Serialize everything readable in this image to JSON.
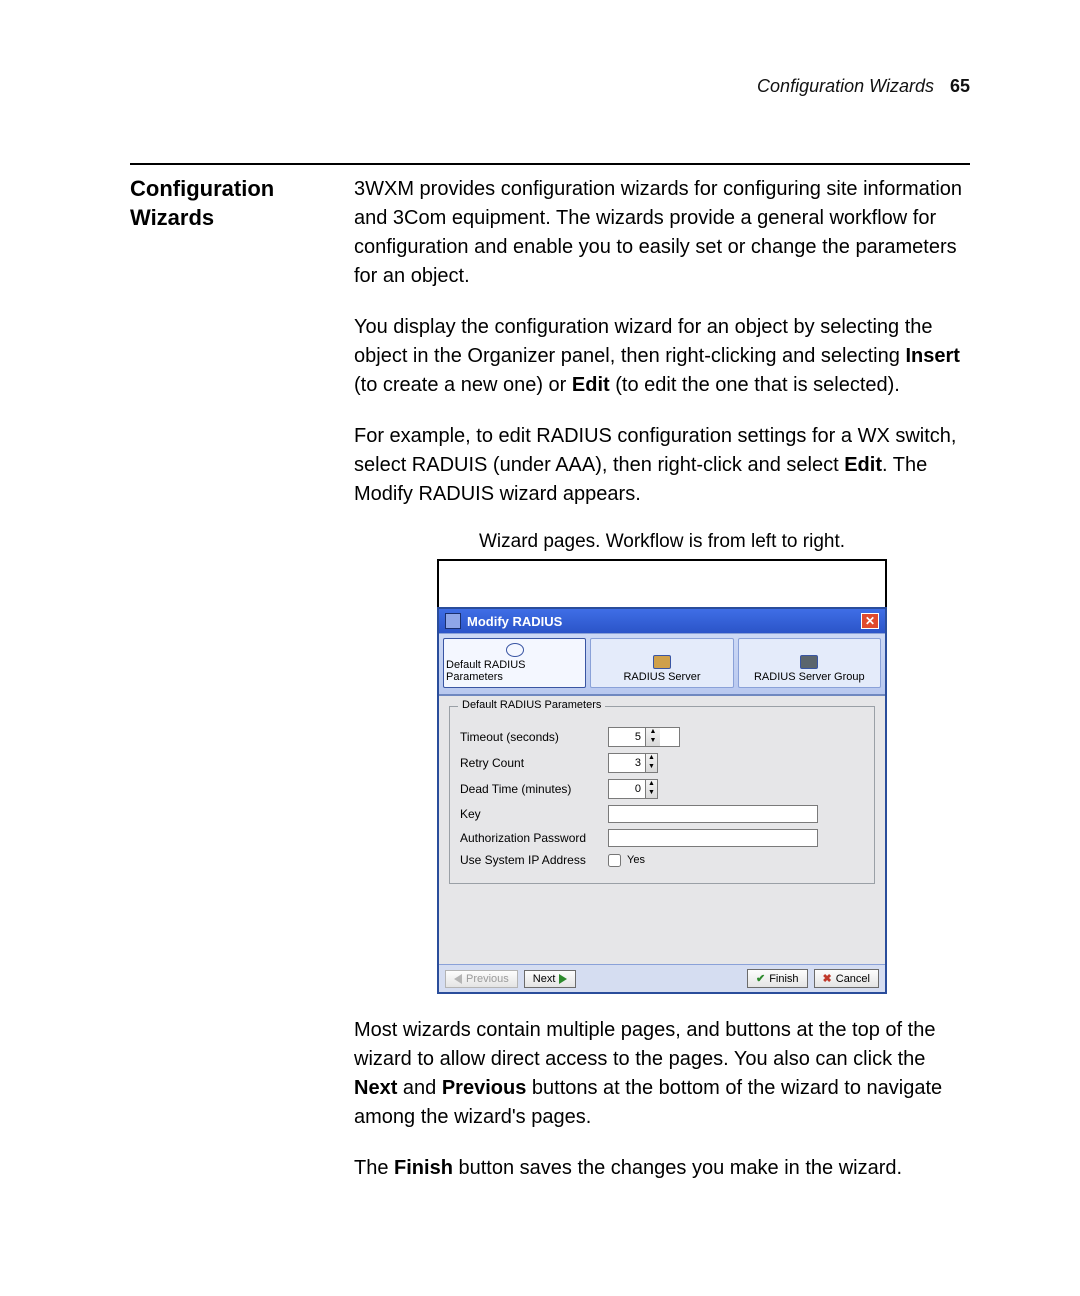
{
  "header": {
    "section_name": "Configuration Wizards",
    "page_number": "65"
  },
  "sidebar": {
    "heading_line1": "Configuration",
    "heading_line2": "Wizards"
  },
  "body": {
    "p1": "3WXM provides configuration wizards for configuring site information and 3Com equipment. The wizards provide a general workflow for configuration and enable you to easily set or change the parameters for an object.",
    "p2a": "You display the configuration wizard for an object by selecting the object in the Organizer panel, then right-clicking and selecting ",
    "p2b_insert": "Insert",
    "p2c": " (to create a new one) or ",
    "p2d_edit": "Edit",
    "p2e": " (to edit the one that is selected).",
    "p3a": "For example, to edit RADIUS configuration settings for a WX switch, select RADUIS (under AAA), then right-click and select ",
    "p3b_edit": "Edit",
    "p3c": ". The Modify RADUIS wizard appears.",
    "caption": "Wizard pages. Workflow is from left to right.",
    "p4a": "Most wizards contain multiple pages, and buttons at the top of the wizard to allow direct access to the pages. You also can click the ",
    "p4b_next": "Next",
    "p4c": " and ",
    "p4d_prev": "Previous",
    "p4e": " buttons at the bottom of the wizard to navigate among the wizard's pages.",
    "p5a": "The ",
    "p5b_finish": "Finish",
    "p5c": " button saves the changes you make in the wizard."
  },
  "dialog": {
    "title": "Modify RADIUS",
    "tabs": [
      "Default RADIUS Parameters",
      "RADIUS Server",
      "RADIUS Server Group"
    ],
    "legend": "Default RADIUS Parameters",
    "fields": {
      "timeout_label": "Timeout (seconds)",
      "timeout_value": "5",
      "retry_label": "Retry Count",
      "retry_value": "3",
      "deadtime_label": "Dead Time (minutes)",
      "deadtime_value": "0",
      "key_label": "Key",
      "auth_label": "Authorization Password",
      "sysip_label": "Use System IP Address",
      "sysip_check_label": "Yes"
    },
    "buttons": {
      "previous": "Previous",
      "next": "Next",
      "finish": "Finish",
      "cancel": "Cancel"
    }
  }
}
